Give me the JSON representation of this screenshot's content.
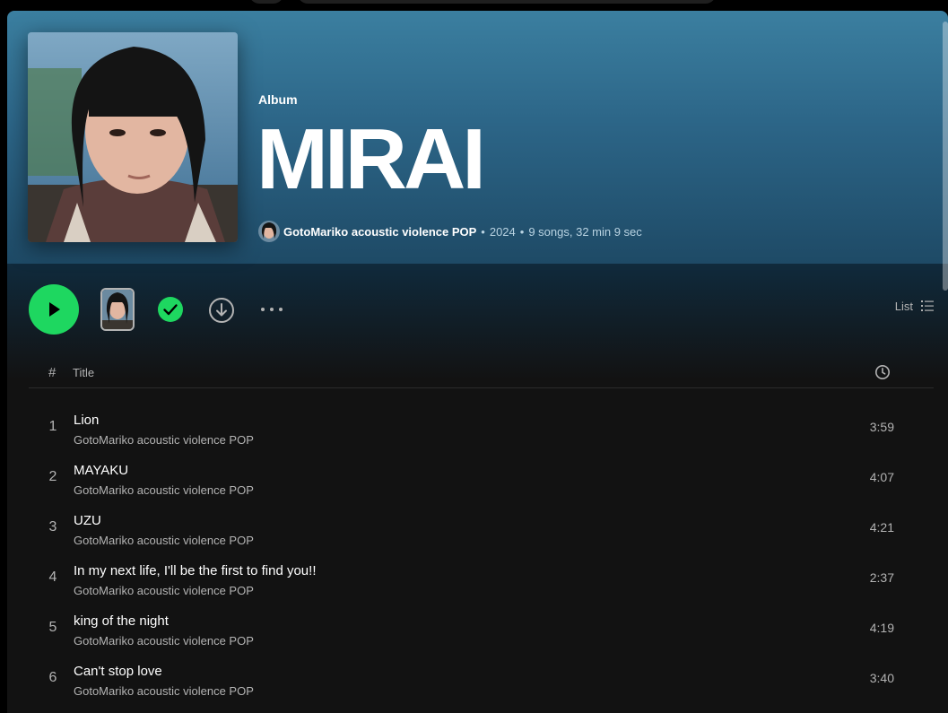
{
  "album": {
    "type_label": "Album",
    "title": "MIRAI",
    "artist": "GotoMariko acoustic violence POP",
    "year": "2024",
    "summary": "9 songs, 32 min 9 sec"
  },
  "controls": {
    "list_label": "List",
    "play_icon": "play-icon",
    "saved_icon": "check-circle-icon",
    "download_icon": "download-icon",
    "more_icon": "more-horizontal-icon",
    "list_icon": "list-icon"
  },
  "table": {
    "number_header": "#",
    "title_header": "Title",
    "duration_icon": "clock-icon"
  },
  "tracks": [
    {
      "number": "1",
      "title": "Lion",
      "artist": "GotoMariko acoustic violence POP",
      "duration": "3:59"
    },
    {
      "number": "2",
      "title": "MAYAKU",
      "artist": "GotoMariko acoustic violence POP",
      "duration": "4:07"
    },
    {
      "number": "3",
      "title": "UZU",
      "artist": "GotoMariko acoustic violence POP",
      "duration": "4:21"
    },
    {
      "number": "4",
      "title": "In my next life, I'll be the first to find you!!",
      "artist": "GotoMariko acoustic violence POP",
      "duration": "2:37"
    },
    {
      "number": "5",
      "title": "king of the night",
      "artist": "GotoMariko acoustic violence POP",
      "duration": "4:19"
    },
    {
      "number": "6",
      "title": "Can't stop love",
      "artist": "GotoMariko acoustic violence POP",
      "duration": "3:40"
    }
  ],
  "colors": {
    "accent": "#1ed760",
    "hero_top": "#3b7fa0",
    "background": "#121212"
  }
}
